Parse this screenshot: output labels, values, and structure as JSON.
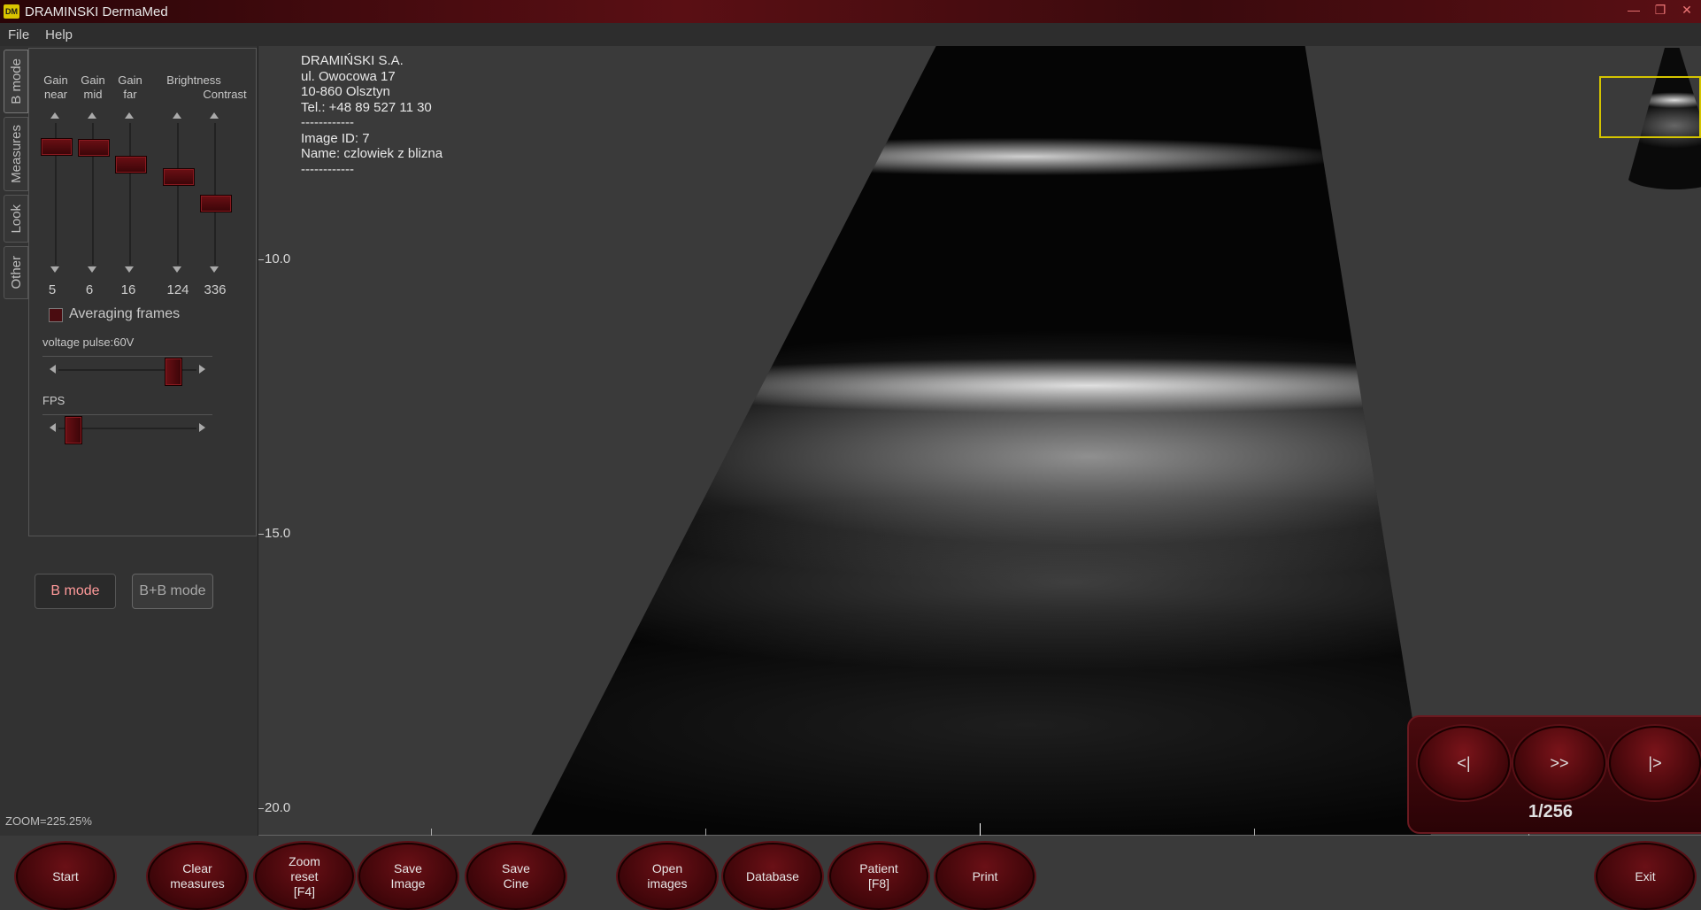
{
  "window": {
    "title": "DRAMINSKI DermaMed",
    "logo": "DM"
  },
  "menu": [
    "File",
    "Help"
  ],
  "vtabs": [
    "B mode",
    "Measures",
    "Look",
    "Other"
  ],
  "sliders": [
    {
      "label": "Gain\nnear",
      "value": "5",
      "level": 0.12
    },
    {
      "label": "Gain\nmid",
      "value": "6",
      "level": 0.13
    },
    {
      "label": "Gain\nfar",
      "value": "16",
      "level": 0.26
    },
    {
      "label": "Brightness",
      "value": "124",
      "level": 0.36
    },
    {
      "label": "Contrast",
      "value": "336",
      "level": 0.57
    }
  ],
  "averaging_label": "Averaging frames",
  "voltage_label": "voltage pulse:60V",
  "voltage_level": 0.87,
  "fps_label": "FPS",
  "fps_level": 0.05,
  "mode_buttons": {
    "b_mode": "B mode",
    "bb_mode": "B+B mode"
  },
  "zoom_text": "ZOOM=225.25%",
  "info": [
    "DRAMIŃSKI S.A.",
    "ul. Owocowa 17",
    "10-860 Olsztyn",
    "Tel.: +48 89 527 11 30",
    "------------",
    "Image ID: 7",
    "Name: czlowiek z blizna",
    "------------"
  ],
  "depth_scale": [
    "10.0",
    "15.0",
    "20.0"
  ],
  "cine": {
    "prev": "<|",
    "play": ">>",
    "next": "|>",
    "counter": "1/256"
  },
  "bottom_buttons": {
    "start": "Start",
    "clear_measures": "Clear\nmeasures",
    "zoom_reset": "Zoom\nreset\n[F4]",
    "save_image": "Save\nImage",
    "save_cine": "Save\nCine",
    "open_images": "Open\nimages",
    "database": "Database",
    "patient": "Patient\n[F8]",
    "print": "Print",
    "exit": "Exit"
  },
  "colors": {
    "accent": "#6a0f14",
    "highlight": "#d4c400",
    "mode_active_text": "#ff9a9a"
  }
}
